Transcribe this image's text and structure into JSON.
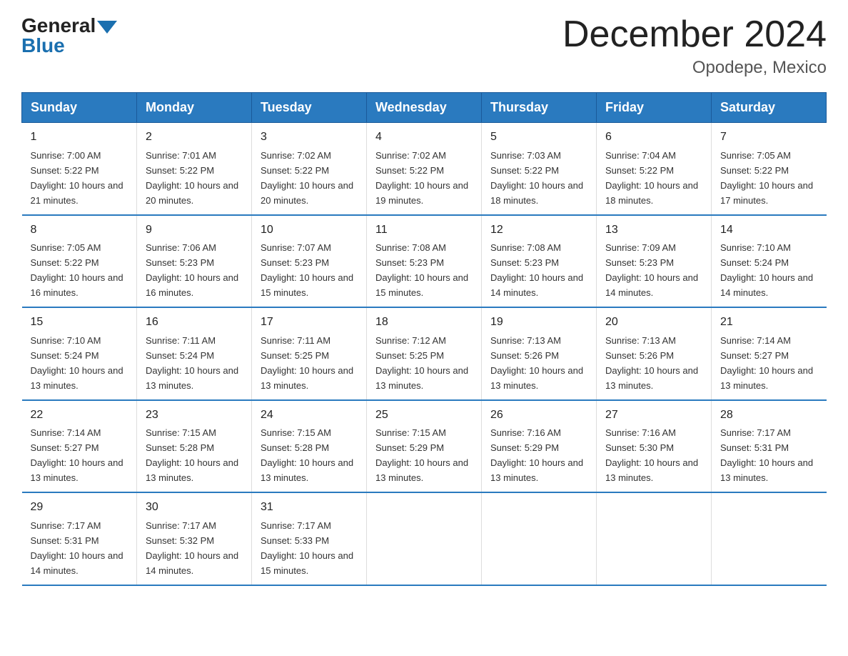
{
  "logo": {
    "general": "General",
    "blue": "Blue"
  },
  "title": "December 2024",
  "subtitle": "Opodepe, Mexico",
  "days_header": [
    "Sunday",
    "Monday",
    "Tuesday",
    "Wednesday",
    "Thursday",
    "Friday",
    "Saturday"
  ],
  "weeks": [
    [
      {
        "day": "1",
        "sunrise": "7:00 AM",
        "sunset": "5:22 PM",
        "daylight": "10 hours and 21 minutes."
      },
      {
        "day": "2",
        "sunrise": "7:01 AM",
        "sunset": "5:22 PM",
        "daylight": "10 hours and 20 minutes."
      },
      {
        "day": "3",
        "sunrise": "7:02 AM",
        "sunset": "5:22 PM",
        "daylight": "10 hours and 20 minutes."
      },
      {
        "day": "4",
        "sunrise": "7:02 AM",
        "sunset": "5:22 PM",
        "daylight": "10 hours and 19 minutes."
      },
      {
        "day": "5",
        "sunrise": "7:03 AM",
        "sunset": "5:22 PM",
        "daylight": "10 hours and 18 minutes."
      },
      {
        "day": "6",
        "sunrise": "7:04 AM",
        "sunset": "5:22 PM",
        "daylight": "10 hours and 18 minutes."
      },
      {
        "day": "7",
        "sunrise": "7:05 AM",
        "sunset": "5:22 PM",
        "daylight": "10 hours and 17 minutes."
      }
    ],
    [
      {
        "day": "8",
        "sunrise": "7:05 AM",
        "sunset": "5:22 PM",
        "daylight": "10 hours and 16 minutes."
      },
      {
        "day": "9",
        "sunrise": "7:06 AM",
        "sunset": "5:23 PM",
        "daylight": "10 hours and 16 minutes."
      },
      {
        "day": "10",
        "sunrise": "7:07 AM",
        "sunset": "5:23 PM",
        "daylight": "10 hours and 15 minutes."
      },
      {
        "day": "11",
        "sunrise": "7:08 AM",
        "sunset": "5:23 PM",
        "daylight": "10 hours and 15 minutes."
      },
      {
        "day": "12",
        "sunrise": "7:08 AM",
        "sunset": "5:23 PM",
        "daylight": "10 hours and 14 minutes."
      },
      {
        "day": "13",
        "sunrise": "7:09 AM",
        "sunset": "5:23 PM",
        "daylight": "10 hours and 14 minutes."
      },
      {
        "day": "14",
        "sunrise": "7:10 AM",
        "sunset": "5:24 PM",
        "daylight": "10 hours and 14 minutes."
      }
    ],
    [
      {
        "day": "15",
        "sunrise": "7:10 AM",
        "sunset": "5:24 PM",
        "daylight": "10 hours and 13 minutes."
      },
      {
        "day": "16",
        "sunrise": "7:11 AM",
        "sunset": "5:24 PM",
        "daylight": "10 hours and 13 minutes."
      },
      {
        "day": "17",
        "sunrise": "7:11 AM",
        "sunset": "5:25 PM",
        "daylight": "10 hours and 13 minutes."
      },
      {
        "day": "18",
        "sunrise": "7:12 AM",
        "sunset": "5:25 PM",
        "daylight": "10 hours and 13 minutes."
      },
      {
        "day": "19",
        "sunrise": "7:13 AM",
        "sunset": "5:26 PM",
        "daylight": "10 hours and 13 minutes."
      },
      {
        "day": "20",
        "sunrise": "7:13 AM",
        "sunset": "5:26 PM",
        "daylight": "10 hours and 13 minutes."
      },
      {
        "day": "21",
        "sunrise": "7:14 AM",
        "sunset": "5:27 PM",
        "daylight": "10 hours and 13 minutes."
      }
    ],
    [
      {
        "day": "22",
        "sunrise": "7:14 AM",
        "sunset": "5:27 PM",
        "daylight": "10 hours and 13 minutes."
      },
      {
        "day": "23",
        "sunrise": "7:15 AM",
        "sunset": "5:28 PM",
        "daylight": "10 hours and 13 minutes."
      },
      {
        "day": "24",
        "sunrise": "7:15 AM",
        "sunset": "5:28 PM",
        "daylight": "10 hours and 13 minutes."
      },
      {
        "day": "25",
        "sunrise": "7:15 AM",
        "sunset": "5:29 PM",
        "daylight": "10 hours and 13 minutes."
      },
      {
        "day": "26",
        "sunrise": "7:16 AM",
        "sunset": "5:29 PM",
        "daylight": "10 hours and 13 minutes."
      },
      {
        "day": "27",
        "sunrise": "7:16 AM",
        "sunset": "5:30 PM",
        "daylight": "10 hours and 13 minutes."
      },
      {
        "day": "28",
        "sunrise": "7:17 AM",
        "sunset": "5:31 PM",
        "daylight": "10 hours and 13 minutes."
      }
    ],
    [
      {
        "day": "29",
        "sunrise": "7:17 AM",
        "sunset": "5:31 PM",
        "daylight": "10 hours and 14 minutes."
      },
      {
        "day": "30",
        "sunrise": "7:17 AM",
        "sunset": "5:32 PM",
        "daylight": "10 hours and 14 minutes."
      },
      {
        "day": "31",
        "sunrise": "7:17 AM",
        "sunset": "5:33 PM",
        "daylight": "10 hours and 15 minutes."
      },
      null,
      null,
      null,
      null
    ]
  ]
}
